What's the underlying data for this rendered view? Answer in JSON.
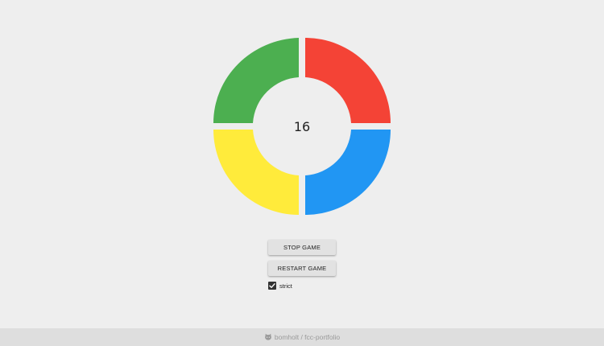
{
  "game": {
    "counter": "16",
    "colors": {
      "green": "#4caf50",
      "red": "#f44336",
      "yellow": "#ffeb3b",
      "blue": "#2196f3",
      "background": "#eeeeee"
    }
  },
  "controls": {
    "stop_label": "STOP GAME",
    "restart_label": "RESTART GAME",
    "strict_label": "strict",
    "strict_checked": true
  },
  "footer": {
    "icon": "github-cat-icon",
    "link_text": "bomholt / fcc-portfolio"
  }
}
